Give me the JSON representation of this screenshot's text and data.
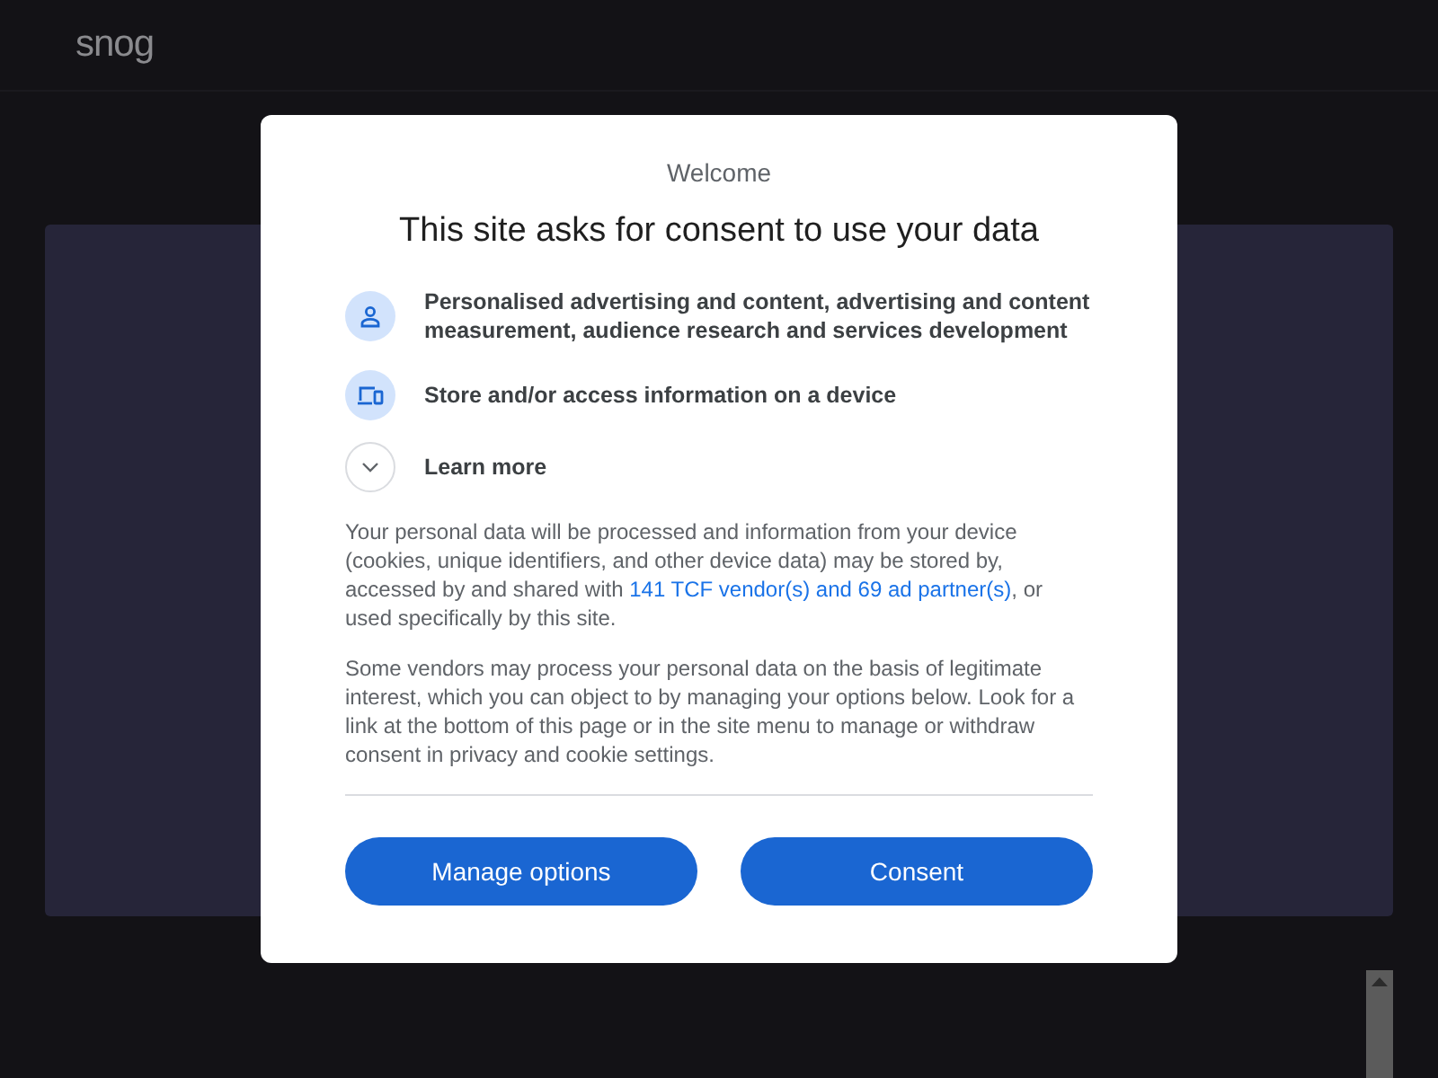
{
  "header": {
    "logo": "snog"
  },
  "dialog": {
    "eyebrow": "Welcome",
    "title": "This site asks for consent to use your data",
    "purposes": [
      {
        "kind": "person",
        "text": "Personalised advertising and content, advertising and content measurement, audience research and services development"
      },
      {
        "kind": "device",
        "text": "Store and/or access information on a device"
      },
      {
        "kind": "expand",
        "text": "Learn more",
        "expanded": false
      }
    ],
    "paragraphs": [
      {
        "before": "Your personal data will be processed and information from your device (cookies, unique identifiers, and other device data) may be stored by, accessed by and shared with ",
        "link": "141 TCF vendor(s) and 69 ad partner(s)",
        "after": ", or used specifically by this site."
      },
      {
        "before": "Some vendors may process your personal data on the basis of legitimate interest, which you can object to by managing your options below. Look for a link at the bottom of this page or in the site menu to manage or withdraw consent in privacy and cookie settings."
      }
    ],
    "buttons": [
      "Manage options",
      "Consent"
    ]
  }
}
